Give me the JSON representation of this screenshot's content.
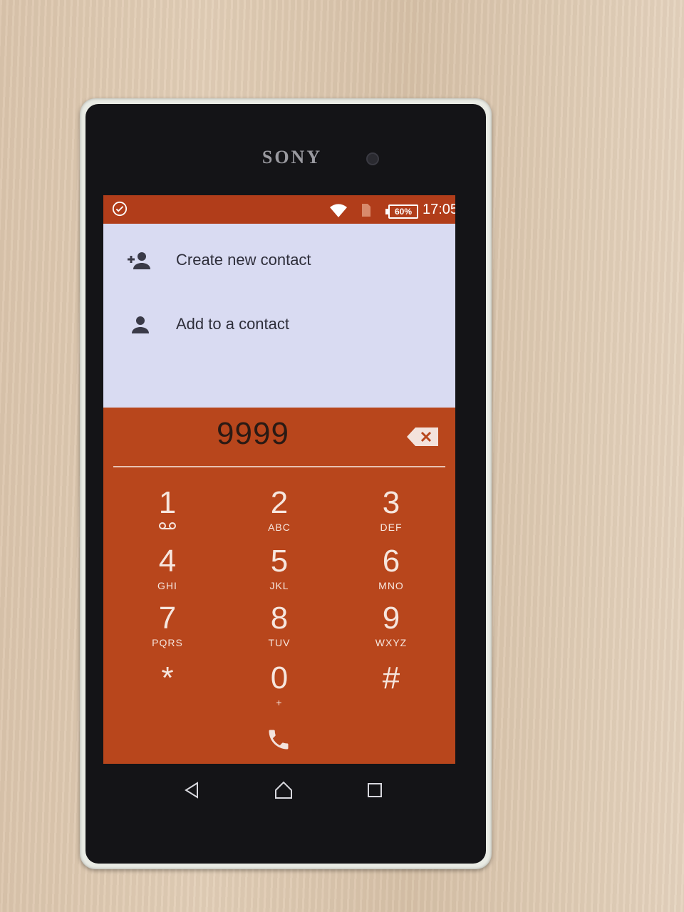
{
  "device": {
    "brand": "SONY"
  },
  "statusbar": {
    "battery": "60%",
    "time": "17:05"
  },
  "actions": [
    {
      "label": "Create new contact",
      "icon": "add-person-icon"
    },
    {
      "label": "Add to a contact",
      "icon": "person-icon"
    }
  ],
  "dialer": {
    "number": "9999",
    "keys": [
      {
        "digit": "1",
        "letters": ""
      },
      {
        "digit": "2",
        "letters": "ABC"
      },
      {
        "digit": "3",
        "letters": "DEF"
      },
      {
        "digit": "4",
        "letters": "GHI"
      },
      {
        "digit": "5",
        "letters": "JKL"
      },
      {
        "digit": "6",
        "letters": "MNO"
      },
      {
        "digit": "7",
        "letters": "PQRS"
      },
      {
        "digit": "8",
        "letters": "TUV"
      },
      {
        "digit": "9",
        "letters": "WXYZ"
      },
      {
        "digit": "*",
        "letters": ""
      },
      {
        "digit": "0",
        "letters": "+"
      },
      {
        "digit": "#",
        "letters": ""
      }
    ]
  },
  "colors": {
    "accent": "#b8461c",
    "statusbar": "#b13d1a",
    "actions_bg": "#d9dbf2"
  }
}
